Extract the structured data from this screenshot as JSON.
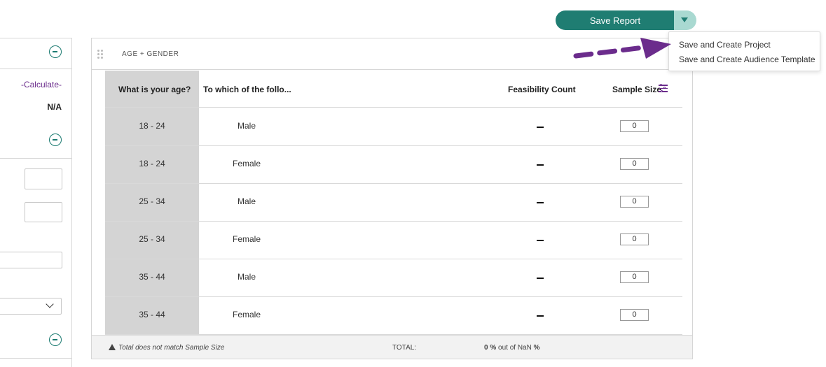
{
  "toolbar": {
    "save_label": "Save Report"
  },
  "menu": {
    "items": [
      "Save and Create Project",
      "Save and Create Audience Template"
    ]
  },
  "left_panel": {
    "calculate_link": "-Calculate-",
    "na_value": "N/A"
  },
  "card": {
    "title": "AGE + GENDER",
    "columns": [
      "What is your age?",
      "To which of the follo...",
      "Feasibility Count",
      "Sample Size"
    ],
    "rows": [
      {
        "age": "18 - 24",
        "gender": "Male",
        "sample": "0"
      },
      {
        "age": "18 - 24",
        "gender": "Female",
        "sample": "0"
      },
      {
        "age": "25 - 34",
        "gender": "Male",
        "sample": "0"
      },
      {
        "age": "25 - 34",
        "gender": "Female",
        "sample": "0"
      },
      {
        "age": "35 - 44",
        "gender": "Male",
        "sample": "0"
      },
      {
        "age": "35 - 44",
        "gender": "Female",
        "sample": "0"
      }
    ],
    "footer": {
      "warning": "Total does not match Sample Size",
      "total_label": "TOTAL:",
      "total_pct": "0",
      "total_rest": "out of NaN"
    }
  },
  "colors": {
    "accent": "#1f7d72",
    "accent_light": "#a9d9d1",
    "link": "#6b2c8c",
    "annotation_arrow": "#6b2c8c"
  },
  "icons": [
    "circle-minus-icon",
    "chevron-down-icon",
    "drag-handle-icon",
    "sliders-icon",
    "warning-icon",
    "caret-down-icon"
  ]
}
